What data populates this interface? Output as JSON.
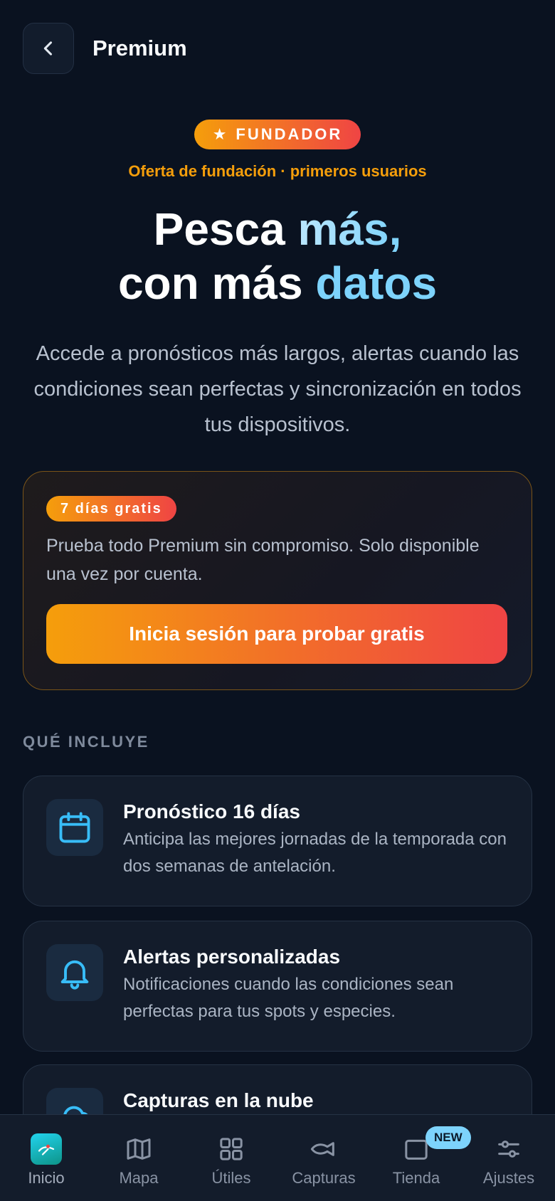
{
  "header": {
    "title": "Premium"
  },
  "hero": {
    "badge": "FUNDADOR",
    "badge_icon": "star-icon",
    "offer": "Oferta de fundación · primeros usuarios",
    "headline_line1_a": "Pesca ",
    "headline_line1_b": "más,",
    "headline_line2_a": "con más ",
    "headline_line2_b": "datos",
    "subtitle": "Accede a pronósticos más largos, alertas cuando las condiciones sean perfectas y sincronización en todos tus dispositivos."
  },
  "trial": {
    "badge": "7 días gratis",
    "text": "Prueba todo Premium sin compromiso. Solo disponible una vez por cuenta.",
    "cta": "Inicia sesión para probar gratis"
  },
  "section": {
    "label": "QUÉ INCLUYE"
  },
  "features": [
    {
      "icon": "calendar-icon",
      "title": "Pronóstico 16 días",
      "desc": "Anticipa las mejores jornadas de la temporada con dos semanas de antelación."
    },
    {
      "icon": "bell-icon",
      "title": "Alertas personalizadas",
      "desc": "Notificaciones cuando las condiciones sean perfectas para tus spots y especies."
    },
    {
      "icon": "cloud-icon",
      "title": "Capturas en la nube",
      "desc": ""
    }
  ],
  "nav": {
    "items": [
      {
        "label": "Inicio",
        "icon": "app-logo-icon",
        "active": true
      },
      {
        "label": "Mapa",
        "icon": "map-icon"
      },
      {
        "label": "Útiles",
        "icon": "grid-icon"
      },
      {
        "label": "Capturas",
        "icon": "fish-icon"
      },
      {
        "label": "Tienda",
        "icon": "store-icon",
        "badge": "NEW"
      },
      {
        "label": "Ajustes",
        "icon": "sliders-icon"
      }
    ]
  },
  "colors": {
    "background": "#0a1220",
    "accent_orange": "#f59e0b",
    "accent_red": "#ef4444",
    "accent_blue": "#7dd3fc"
  }
}
